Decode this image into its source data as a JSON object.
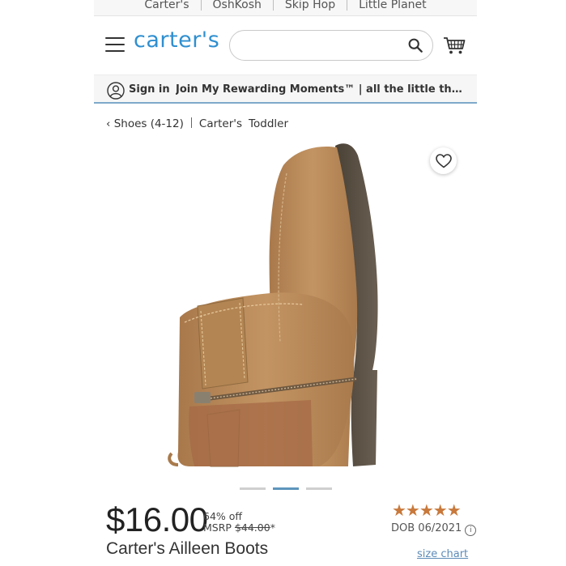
{
  "brands": [
    "Carter's",
    "OshKosh",
    "Skip Hop",
    "Little Planet"
  ],
  "header": {
    "logo_text": "carter's",
    "search_placeholder": "",
    "menu_icon": "hamburger-icon",
    "search_icon": "search-icon",
    "cart_icon": "cart-icon"
  },
  "rewards": {
    "signin_label": "Sign in",
    "promo_text": "Join My Rewarding Moments™ | all the little things add up",
    "user_icon": "user-circle-icon"
  },
  "breadcrumb": {
    "back": "‹ Shoes (4-12)",
    "brand": "Carter's",
    "category": "Toddler"
  },
  "carousel": {
    "slides": 3,
    "active_index": 1
  },
  "product": {
    "price": "$16.00",
    "discount": "64% off",
    "msrp_label": "MSRP",
    "msrp_value": "$44.00",
    "msrp_asterisk": "*",
    "rating_stars": "★★★★★",
    "rating_value": 5,
    "dob": "DOB 06/2021",
    "name": "Carter's Ailleen Boots",
    "size_chart": "size chart"
  },
  "colors": {
    "brand_blue": "#2f8fd0",
    "star_color": "#c8793b",
    "boot_tan": "#b98855"
  }
}
